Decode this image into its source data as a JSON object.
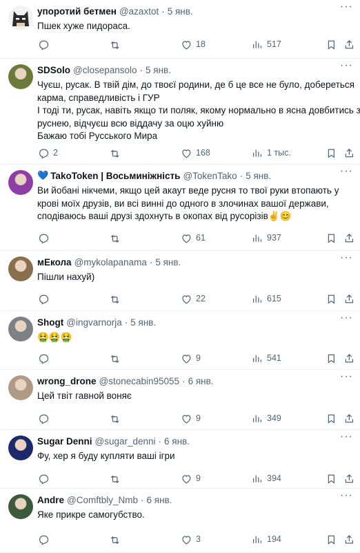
{
  "tweets": [
    {
      "name": "упоротий бетмен",
      "handle": "@azaxtot",
      "date": "5 янв.",
      "lines": [
        "Пшек хуже пидораса."
      ],
      "replies": "",
      "retweets": "",
      "likes": "18",
      "views": "517",
      "avatar_color": "#2b2b2b",
      "avatar_icon": "batman-mask-icon"
    },
    {
      "name": "SDSolo",
      "handle": "@closepansolo",
      "date": "5 янв.",
      "lines": [
        "Чуєш, русак. В твій дім, до твоєї родини, де б це все не було, добереться",
        "карма, справедливість і ГУР",
        "І тоді ти, русак, навіть якщо ти поляк, якому нормально в ясна довбитись з",
        "руснею, відчуєш всю віддачу за оцю хуйню",
        "Бажаю тобі Русського Мира"
      ],
      "replies": "2",
      "retweets": "",
      "likes": "168",
      "views": "1 тыс.",
      "avatar_color": "#6b7a3a",
      "avatar_icon": "photo-avatar-icon"
    },
    {
      "name": "TakoToken | Восьминіжність",
      "name_prefix": "💙",
      "handle": "@TokenTako",
      "date": "5 янв.",
      "lines": [
        "Ви йобані нікчеми, якщо цей акаут веде русня то твої руки втопають у",
        "крові моїх друзів, ви всі винні до одного в злочинах вашої держави,",
        "сподіваюсь ваші друзі здохнуть в окопах від русорізів✌️😊"
      ],
      "replies": "",
      "retweets": "",
      "likes": "61",
      "views": "937",
      "avatar_color": "#8e3fa6",
      "avatar_icon": "anime-avatar-icon"
    },
    {
      "name": "мЕкола",
      "handle": "@mykolapanama",
      "date": "5 янв.",
      "lines": [
        "Пішли нахуй)"
      ],
      "replies": "",
      "retweets": "",
      "likes": "22",
      "views": "615",
      "avatar_color": "#8a6f4e",
      "avatar_icon": "photo-avatar-icon"
    },
    {
      "name": "Shogt",
      "handle": "@ingvarnorja",
      "date": "5 янв.",
      "lines": [
        "🤮🤮🤮"
      ],
      "replies": "",
      "retweets": "",
      "likes": "9",
      "views": "541",
      "avatar_color": "#7d8084",
      "avatar_icon": "photo-avatar-icon"
    },
    {
      "name": "wrong_drone",
      "handle": "@stonecabin95055",
      "date": "6 янв.",
      "lines": [
        "Цей твіт гавной воняє"
      ],
      "replies": "",
      "retweets": "",
      "likes": "9",
      "views": "349",
      "avatar_color": "#b19a83",
      "avatar_icon": "photo-avatar-icon"
    },
    {
      "name": "Sugar Denni",
      "handle": "@sugar_denni",
      "date": "6 янв.",
      "lines": [
        "Фу, хер я буду купляти ваші ігри"
      ],
      "replies": "",
      "retweets": "",
      "likes": "9",
      "views": "394",
      "avatar_color": "#1c2a6b",
      "avatar_icon": "photo-avatar-icon"
    },
    {
      "name": "Andre",
      "handle": "@Comftbly_Nmb",
      "date": "6 янв.",
      "lines": [
        "Яке прикре самогубство."
      ],
      "replies": "",
      "retweets": "",
      "likes": "3",
      "views": "194",
      "avatar_color": "#3d5a3c",
      "avatar_icon": "photo-avatar-icon"
    }
  ],
  "more_label": "···",
  "dot": "·",
  "colors": {
    "text": "#0f1419",
    "muted": "#536471",
    "divider": "#eff3f4"
  }
}
